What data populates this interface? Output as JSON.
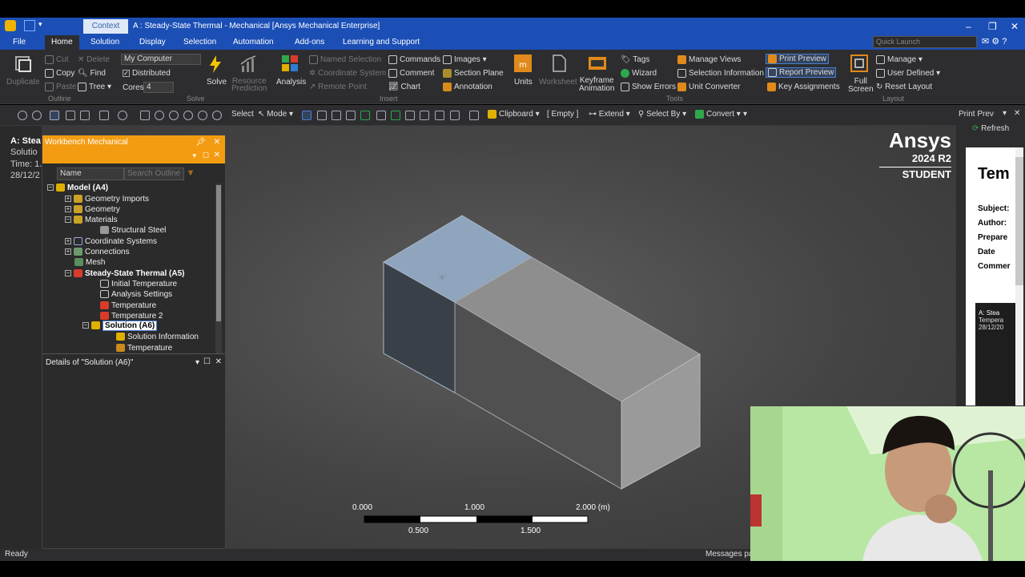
{
  "app": {
    "title": "A : Steady-State Thermal - Mechanical [Ansys Mechanical Enterprise]",
    "context_tab": "Context"
  },
  "tabs": [
    "File",
    "Home",
    "Solution",
    "Display",
    "Selection",
    "Automation",
    "Add-ons",
    "Learning and Support"
  ],
  "active_tab": "Home",
  "quick_launch_placeholder": "Quick Launch",
  "ribbon": {
    "duplicate": "Duplicate",
    "cut": "Cut",
    "copy": "Copy",
    "paste": "Paste",
    "delete": "Delete",
    "find": "Find",
    "tree": "Tree",
    "outline_group": "Outline",
    "computer": "My Computer",
    "distributed": "Distributed",
    "cores_label": "Cores",
    "cores_value": "4",
    "solve": "Solve",
    "solve_group": "Solve",
    "resource_prediction": "Resource\nPrediction",
    "analysis": "Analysis",
    "named_selection": "Named Selection",
    "coordinate_system": "Coordinate System",
    "remote_point": "Remote Point",
    "commands": "Commands",
    "comment": "Comment",
    "chart": "Chart",
    "images": "Images",
    "section_plane": "Section Plane",
    "annotation": "Annotation",
    "insert_group": "Insert",
    "units": "Units",
    "worksheet": "Worksheet",
    "keyframe_animation": "Keyframe\nAnimation",
    "tags": "Tags",
    "wizard": "Wizard",
    "show_errors": "Show Errors",
    "manage_views": "Manage Views",
    "selection_information": "Selection Information",
    "unit_converter": "Unit Converter",
    "tools_group": "Tools",
    "print_preview": "Print Preview",
    "report_preview": "Report Preview",
    "key_assignments": "Key Assignments",
    "full_screen": "Full\nScreen",
    "manage": "Manage",
    "user_defined": "User Defined",
    "reset_layout": "Reset Layout",
    "layout_group": "Layout"
  },
  "toolbar": {
    "select": "Select",
    "mode": "Mode",
    "clipboard": "Clipboard",
    "empty": "[ Empty ]",
    "extend": "Extend",
    "select_by": "Select By",
    "convert": "Convert"
  },
  "left_info": {
    "line1": "A: Stea",
    "line2": "Solutio",
    "line3": "Time: 1.",
    "line4": "28/12/2"
  },
  "outline": {
    "title": "Workbench Mechanical",
    "column_name": "Name",
    "search_placeholder": "Search Outline",
    "items": [
      {
        "label": "Model (A4)",
        "bold": true
      },
      {
        "label": "Geometry Imports"
      },
      {
        "label": "Geometry"
      },
      {
        "label": "Materials"
      },
      {
        "label": "Structural Steel"
      },
      {
        "label": "Coordinate Systems"
      },
      {
        "label": "Connections"
      },
      {
        "label": "Mesh"
      },
      {
        "label": "Steady-State Thermal (A5)",
        "bold": true
      },
      {
        "label": "Initial Temperature"
      },
      {
        "label": "Analysis Settings"
      },
      {
        "label": "Temperature"
      },
      {
        "label": "Temperature 2"
      },
      {
        "label": "Solution (A6)",
        "bold": true
      },
      {
        "label": "Solution Information"
      },
      {
        "label": "Temperature"
      }
    ],
    "details_title": "Details of \"Solution (A6)\""
  },
  "brand": {
    "name": "Ansys",
    "version": "2024 R2",
    "edition": "STUDENT"
  },
  "scale": {
    "top_labels": [
      "0.000",
      "1.000",
      "2.000 (m)"
    ],
    "bottom_labels": [
      "0.500",
      "1.500"
    ]
  },
  "right_panel": {
    "title": "Print Prev",
    "refresh": "Refresh",
    "heading": "Tem",
    "fields": [
      "Subject:",
      "Author:",
      "Prepare",
      "Date",
      "Commer"
    ],
    "caption1": "A: Stea",
    "caption2": "Tempera",
    "caption3": "28/12/20"
  },
  "status": {
    "left": "Ready",
    "right": "Messages pa"
  },
  "colors": {
    "title_blue": "#1b4fb6",
    "outline_orange": "#f39c12",
    "selected_face": "#8fa4bd"
  }
}
